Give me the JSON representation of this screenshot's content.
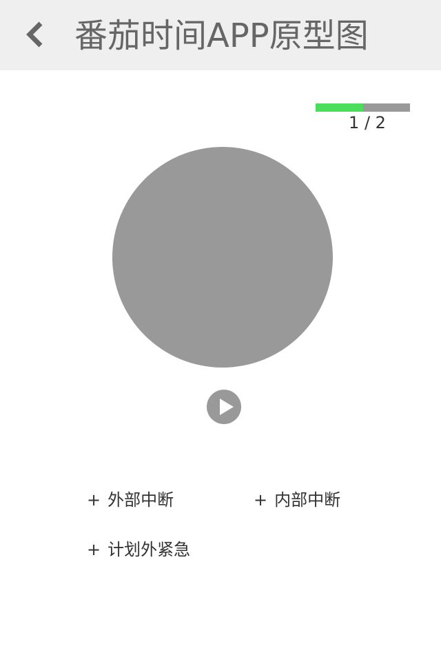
{
  "header": {
    "title": "番茄时间APP原型图",
    "back_icon": "chevron-left-icon"
  },
  "progress": {
    "fraction": 0.5,
    "fill_color": "#4cdd5c",
    "track_color": "#999999",
    "counter": "1 / 2"
  },
  "timer": {
    "circle_color": "#999999",
    "play_icon": "play-icon"
  },
  "actions": [
    {
      "plus": "+",
      "label": "外部中断"
    },
    {
      "plus": "+",
      "label": "内部中断"
    },
    {
      "plus": "+",
      "label": "计划外紧急"
    }
  ]
}
